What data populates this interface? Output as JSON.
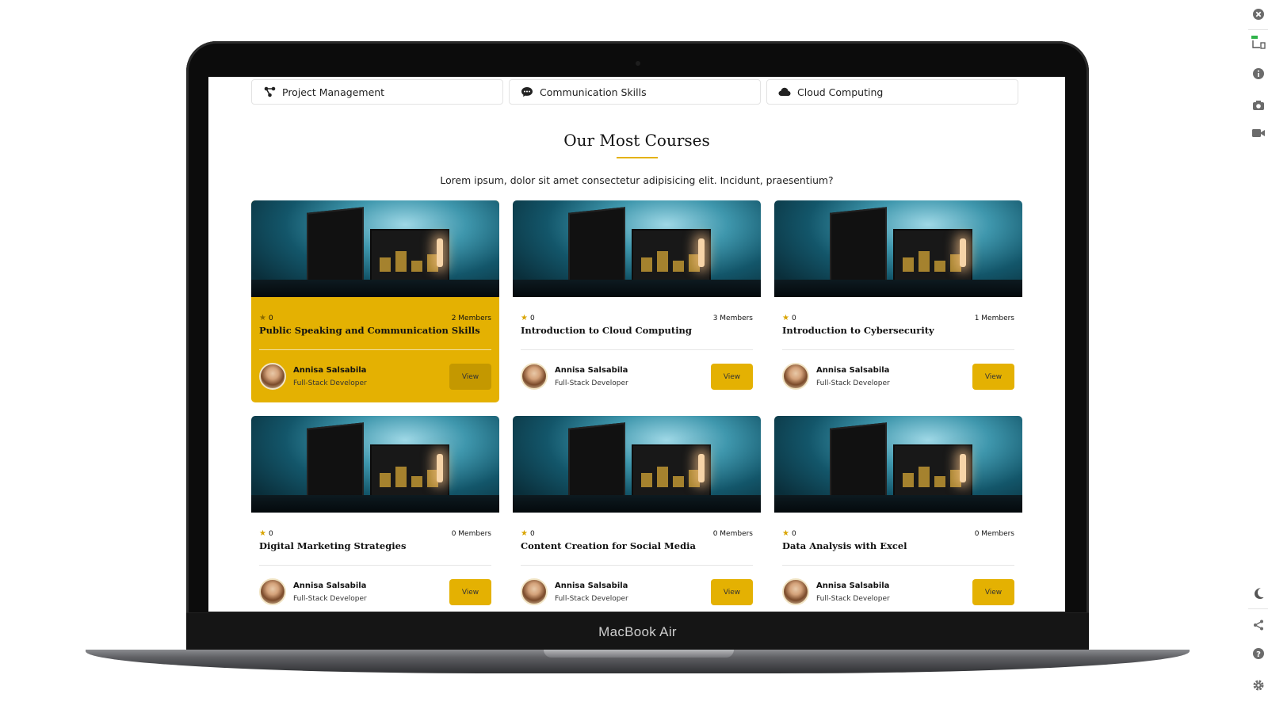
{
  "device": {
    "label": "MacBook Air"
  },
  "tabs": [
    {
      "label": "Project Management",
      "icon": "network-icon"
    },
    {
      "label": "Communication Skills",
      "icon": "chat-bubble-icon"
    },
    {
      "label": "Cloud Computing",
      "icon": "cloud-icon"
    }
  ],
  "section": {
    "title": "Our Most Courses",
    "subtitle": "Lorem ipsum, dolor sit amet consectetur adipisicing elit. Incidunt, praesentium?"
  },
  "courses": [
    {
      "rating": "0",
      "members": "2 Members",
      "title": "Public Speaking and Communication Skills",
      "author": "Annisa Salsabila",
      "role": "Full-Stack Developer",
      "button": "View",
      "highlighted": true
    },
    {
      "rating": "0",
      "members": "3 Members",
      "title": "Introduction to Cloud Computing",
      "author": "Annisa Salsabila",
      "role": "Full-Stack Developer",
      "button": "View"
    },
    {
      "rating": "0",
      "members": "1 Members",
      "title": "Introduction to Cybersecurity",
      "author": "Annisa Salsabila",
      "role": "Full-Stack Developer",
      "button": "View"
    },
    {
      "rating": "0",
      "members": "0 Members",
      "title": "Digital Marketing Strategies",
      "author": "Annisa Salsabila",
      "role": "Full-Stack Developer",
      "button": "View"
    },
    {
      "rating": "0",
      "members": "0 Members",
      "title": "Content Creation for Social Media",
      "author": "Annisa Salsabila",
      "role": "Full-Stack Developer",
      "button": "View"
    },
    {
      "rating": "0",
      "members": "0 Members",
      "title": "Data Analysis with Excel",
      "author": "Annisa Salsabila",
      "role": "Full-Stack Developer",
      "button": "View"
    }
  ],
  "toolbar": {
    "icons": [
      "close-icon",
      "responsive-devices-icon",
      "info-icon",
      "camera-icon",
      "video-icon",
      "moon-icon",
      "share-icon",
      "help-icon",
      "settings-icon"
    ]
  },
  "colors": {
    "accent": "#e4b102",
    "accent_dark": "#c49800",
    "text": "#111111"
  }
}
